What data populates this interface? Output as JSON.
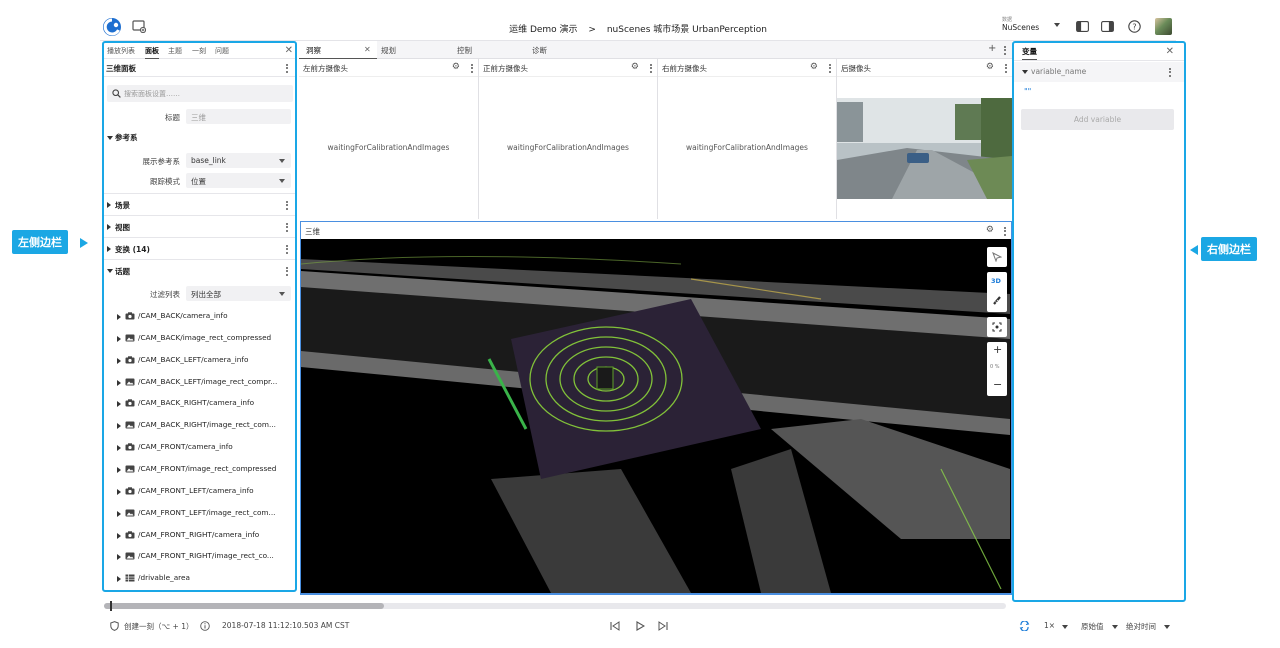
{
  "header": {
    "app": "运维 Demo 演示",
    "separator": ">",
    "scene": "nuScenes 城市场景 UrbanPerception",
    "dataset_hint": "数据",
    "dataset": "NuScenes"
  },
  "left_sidebar": {
    "tabs": [
      "播放列表",
      "面板",
      "主题",
      "一刻",
      "问题"
    ],
    "active_tab": "面板",
    "panel_title": "三维面板",
    "search_placeholder": "搜索面板设置……",
    "title_label": "标题",
    "title_value": "三维",
    "frame_section": "参考系",
    "display_frame_label": "展示参考系",
    "display_frame_value": "base_link",
    "follow_mode_label": "跟踪模式",
    "follow_mode_value": "位置",
    "scene_section": "场景",
    "view_section": "视图",
    "transforms_section": "变换 (14)",
    "topics_section": "话题",
    "filter_label": "过滤列表",
    "filter_value": "列出全部",
    "topics": [
      {
        "name": "/CAM_BACK/camera_info",
        "icon": "camera-icon"
      },
      {
        "name": "/CAM_BACK/image_rect_compressed",
        "icon": "image-icon"
      },
      {
        "name": "/CAM_BACK_LEFT/camera_info",
        "icon": "camera-icon"
      },
      {
        "name": "/CAM_BACK_LEFT/image_rect_compr...",
        "icon": "image-icon"
      },
      {
        "name": "/CAM_BACK_RIGHT/camera_info",
        "icon": "camera-icon"
      },
      {
        "name": "/CAM_BACK_RIGHT/image_rect_com...",
        "icon": "image-icon"
      },
      {
        "name": "/CAM_FRONT/camera_info",
        "icon": "camera-icon"
      },
      {
        "name": "/CAM_FRONT/image_rect_compressed",
        "icon": "image-icon"
      },
      {
        "name": "/CAM_FRONT_LEFT/camera_info",
        "icon": "camera-icon"
      },
      {
        "name": "/CAM_FRONT_LEFT/image_rect_com...",
        "icon": "image-icon"
      },
      {
        "name": "/CAM_FRONT_RIGHT/camera_info",
        "icon": "camera-icon"
      },
      {
        "name": "/CAM_FRONT_RIGHT/image_rect_co...",
        "icon": "image-icon"
      },
      {
        "name": "/drivable_area",
        "icon": "grid-icon"
      }
    ]
  },
  "center": {
    "tabs": [
      "洞察",
      "规划",
      "控制",
      "诊断"
    ],
    "cameras": [
      {
        "title": "左前方摄像头",
        "status": "waitingForCalibrationAndImages"
      },
      {
        "title": "正前方摄像头",
        "status": "waitingForCalibrationAndImages"
      },
      {
        "title": "右前方摄像头",
        "status": "waitingForCalibrationAndImages"
      },
      {
        "title": "后摄像头",
        "status": ""
      }
    ],
    "panel_3d_title": "三维",
    "toolbar": {
      "mode_3d": "3D",
      "zoom_pct": "0 %"
    }
  },
  "right_sidebar": {
    "title": "变量",
    "variable_name": "variable_name",
    "variable_value": "\"\"",
    "add_button": "Add variable"
  },
  "callouts": {
    "left": "左侧边栏",
    "right": "右侧边栏"
  },
  "bottom": {
    "create_moment": "创建一刻（⌥ + 1）",
    "timestamp": "2018-07-18 11:12:10.503 AM CST",
    "speed": "1×",
    "value_mode": "原始值",
    "time_mode": "绝对时间"
  },
  "colors": {
    "accent": "#1ba7e4",
    "selection": "#4a8fe0"
  }
}
